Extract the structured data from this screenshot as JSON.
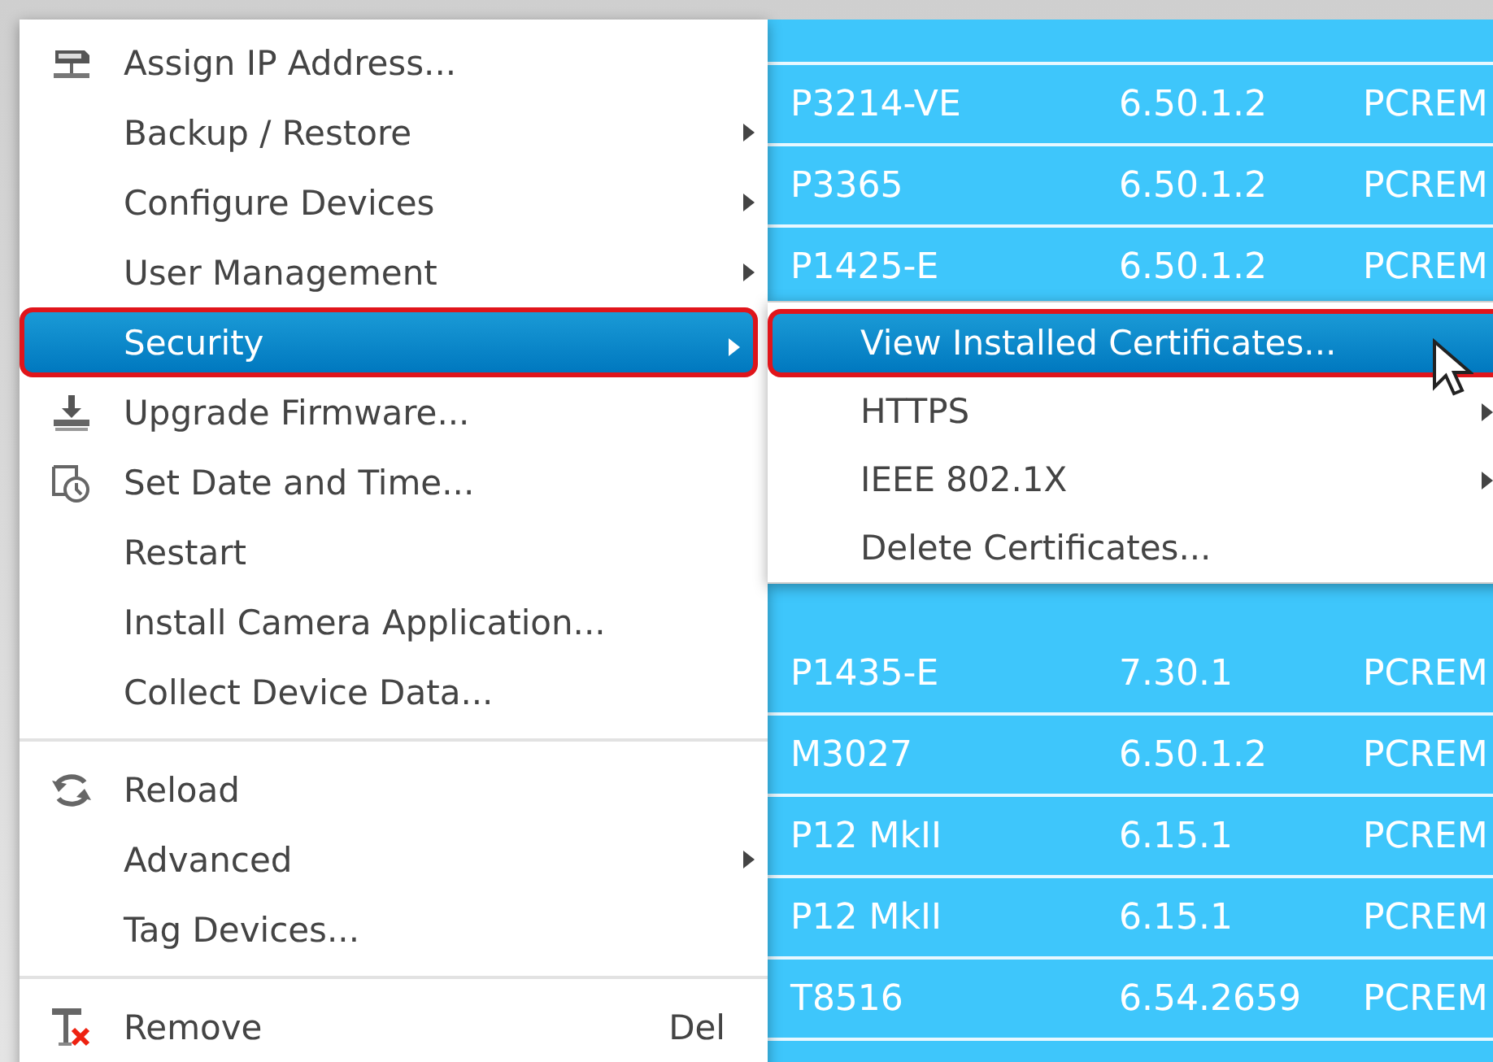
{
  "table": {
    "rows": [
      {
        "model": "P3214-VE",
        "firmware": "6.50.1.2",
        "column_3": "PCREM"
      },
      {
        "model": "P3365",
        "firmware": "6.50.1.2",
        "column_3": "PCREM"
      },
      {
        "model": "P1425-E",
        "firmware": "6.50.1.2",
        "column_3": "PCREM"
      },
      {
        "model": "P1435-E",
        "firmware": "7.30.1",
        "column_3": "PCREM"
      },
      {
        "model": "M3027",
        "firmware": "6.50.1.2",
        "column_3": "PCREM"
      },
      {
        "model": "P12 MkII",
        "firmware": "6.15.1",
        "column_3": "PCREM"
      },
      {
        "model": "P12 MkII",
        "firmware": "6.15.1",
        "column_3": "PCREM"
      },
      {
        "model": "T8516",
        "firmware": "6.54.2659",
        "column_3": "PCREM"
      }
    ]
  },
  "context_menu": {
    "items": [
      {
        "kind": "item",
        "label": "Assign IP Address...",
        "submenu": false,
        "selected": false
      },
      {
        "kind": "item",
        "label": "Backup / Restore",
        "submenu": true,
        "selected": false
      },
      {
        "kind": "item",
        "label": "Configure Devices",
        "submenu": true,
        "selected": false
      },
      {
        "kind": "item",
        "label": "User Management",
        "submenu": true,
        "selected": false
      },
      {
        "kind": "item",
        "label": "Security",
        "submenu": true,
        "selected": true
      },
      {
        "kind": "item",
        "label": "Upgrade Firmware...",
        "submenu": false,
        "selected": false
      },
      {
        "kind": "item",
        "label": "Set Date and Time...",
        "submenu": false,
        "selected": false
      },
      {
        "kind": "item",
        "label": "Restart",
        "submenu": false,
        "selected": false
      },
      {
        "kind": "item",
        "label": "Install Camera Application...",
        "submenu": false,
        "selected": false
      },
      {
        "kind": "item",
        "label": "Collect Device Data...",
        "submenu": false,
        "selected": false
      },
      {
        "kind": "separator"
      },
      {
        "kind": "item",
        "label": "Reload",
        "submenu": false,
        "selected": false
      },
      {
        "kind": "item",
        "label": "Advanced",
        "submenu": true,
        "selected": false
      },
      {
        "kind": "item",
        "label": "Tag Devices...",
        "submenu": false,
        "selected": false
      },
      {
        "kind": "separator"
      },
      {
        "kind": "item",
        "label": "Remove",
        "submenu": false,
        "selected": false,
        "shortcut": "Del"
      }
    ]
  },
  "submenu": {
    "items": [
      {
        "label": "View Installed Certificates...",
        "submenu": false,
        "selected": true
      },
      {
        "label": "HTTPS",
        "submenu": true,
        "selected": false
      },
      {
        "label": "IEEE 802.1X",
        "submenu": true,
        "selected": false
      },
      {
        "label": "Delete Certificates...",
        "submenu": false,
        "selected": false
      }
    ]
  }
}
